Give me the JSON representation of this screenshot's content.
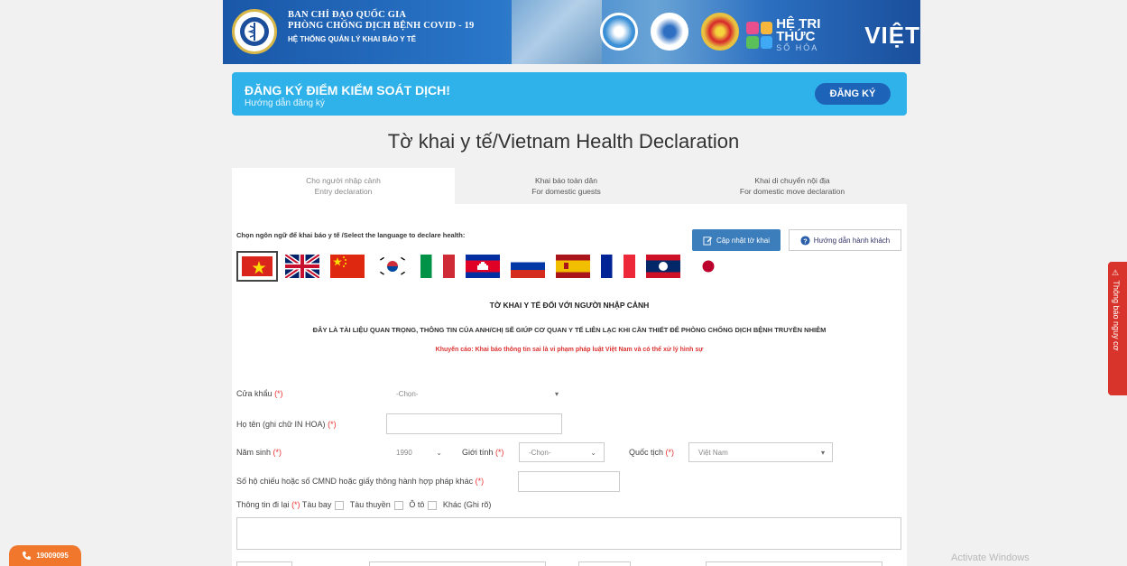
{
  "header": {
    "line1": "BAN CHỈ ĐẠO QUỐC GIA",
    "line2": "PHÒNG CHỐNG DỊCH BỆNH COVID - 19",
    "line3": "HỆ THỐNG QUẢN LÝ KHAI BÁO Y TẾ",
    "brand_name": "HỆ TRI THỨC",
    "brand_sub": "SỐ HÓA",
    "brand_viet": "VIỆT",
    "colors": {
      "banner": "#1a57a8"
    }
  },
  "register": {
    "title": "ĐĂNG KÝ ĐIỂM KIỂM SOÁT DỊCH!",
    "subtitle": "Hướng dẫn đăng ký",
    "button": "ĐĂNG KÝ",
    "color": "#2fb2ea"
  },
  "page_title": "Tờ khai y tế/Vietnam Health Declaration",
  "tabs": [
    {
      "line1": "Cho người nhập cảnh",
      "line2": "Entry declaration"
    },
    {
      "line1": "Khai báo toàn dân",
      "line2": "For domestic guests"
    },
    {
      "line1": "Khai di chuyển nội địa",
      "line2": "For domestic move declaration"
    }
  ],
  "language": {
    "label": "Chọn ngôn ngữ để khai báo y tế /Select the language to declare health:",
    "update_button": "Cập nhật tờ khai",
    "guide_button": "Hướng dẫn hành khách",
    "flags": [
      "vietnam-flag-icon",
      "uk-flag-icon",
      "china-flag-icon",
      "korea-flag-icon",
      "italy-flag-icon",
      "cambodia-flag-icon",
      "russia-flag-icon",
      "spain-flag-icon",
      "france-flag-icon",
      "laos-flag-icon",
      "japan-flag-icon"
    ]
  },
  "form": {
    "heading": "TỜ KHAI Y TẾ ĐỐI VỚI NGƯỜI NHẬP CẢNH",
    "notice": "ĐÂY LÀ TÀI LIỆU QUAN TRỌNG, THÔNG TIN CỦA ANH/CHỊ SẼ GIÚP CƠ QUAN Y TẾ LIÊN LẠC KHI CẦN THIẾT ĐỂ PHÒNG CHỐNG DỊCH BỆNH TRUYỀN NHIỄM",
    "warning": "Khuyến cáo: Khai báo thông tin sai là vi phạm pháp luật Việt Nam và có thể xử lý hình sự",
    "required_mark": "(*)",
    "border_gate_label": "Cửa khẩu",
    "border_gate_value": "-Chọn-",
    "fullname_label": "Họ tên (ghi chữ IN HOA)",
    "birth_year_label": "Năm sinh",
    "birth_year_value": "1990",
    "gender_label": "Giới tính",
    "gender_value": "-Chọn-",
    "nationality_label": "Quốc tịch",
    "nationality_value": "Việt Nam",
    "passport_label": "Số hộ chiếu hoặc số CMND hoặc giấy thông hành hợp pháp khác",
    "travel_label": "Thông tin đi lại",
    "travel_options": [
      "Tàu bay",
      "Tàu thuyền",
      "Ô tô",
      "Khác (Ghi rõ)"
    ]
  },
  "side_report": "Thông báo nguy cơ",
  "hotline": "19009095",
  "watermark": "Activate Windows"
}
